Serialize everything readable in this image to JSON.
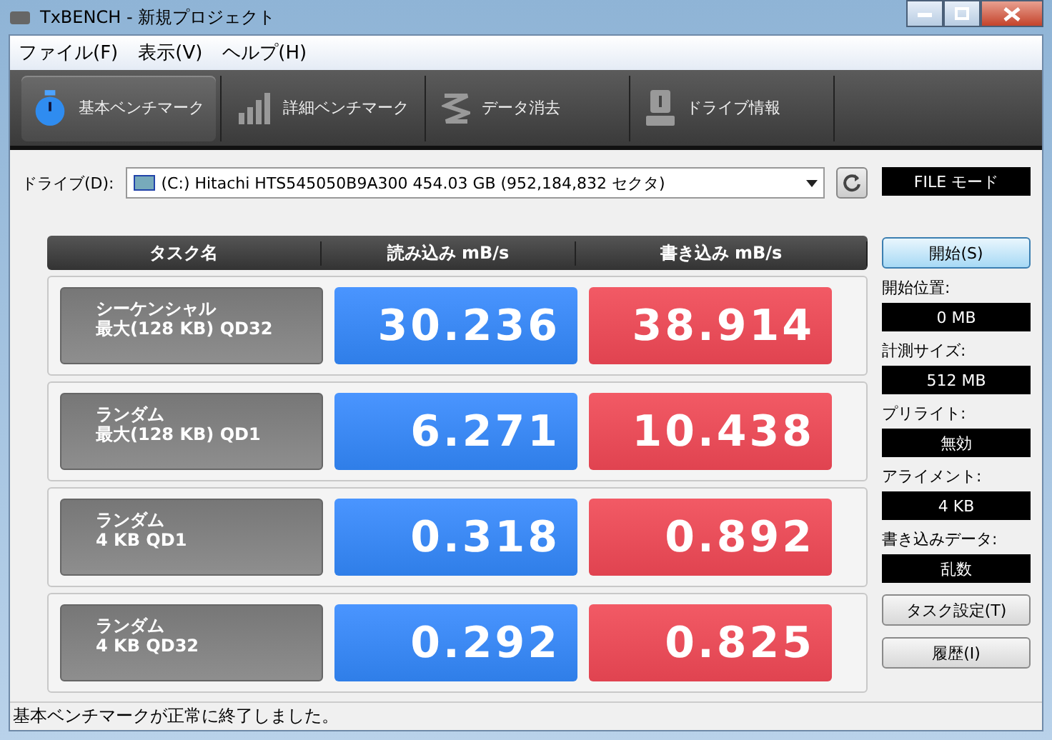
{
  "window": {
    "title": "TxBENCH - 新規プロジェクト"
  },
  "menu": [
    "ファイル(F)",
    "表示(V)",
    "ヘルプ(H)"
  ],
  "tabs": [
    {
      "label": "基本ベンチマーク",
      "selected": true
    },
    {
      "label": "詳細ベンチマーク",
      "selected": false
    },
    {
      "label": "データ消去",
      "selected": false
    },
    {
      "label": "ドライブ情報",
      "selected": false
    }
  ],
  "drive": {
    "label": "ドライブ(D):",
    "value": "(C:) Hitachi HTS545050B9A300  454.03 GB (952,184,832 セクタ)"
  },
  "mode": "FILE モード",
  "table": {
    "columns": [
      "タスク名",
      "読み込み mB/s",
      "書き込み mB/s"
    ],
    "rows": [
      {
        "name": [
          "シーケンシャル",
          "最大(128 KB) QD32"
        ],
        "read": "30.236",
        "write": "38.914"
      },
      {
        "name": [
          "ランダム",
          "最大(128 KB) QD1"
        ],
        "read": "6.271",
        "write": "10.438"
      },
      {
        "name": [
          "ランダム",
          "4 KB QD1"
        ],
        "read": "0.318",
        "write": "0.892"
      },
      {
        "name": [
          "ランダム",
          "4 KB QD32"
        ],
        "read": "0.292",
        "write": "0.825"
      }
    ]
  },
  "start_button": "開始(S)",
  "settings": [
    {
      "label": "開始位置:",
      "value": "0 MB"
    },
    {
      "label": "計測サイズ:",
      "value": "512 MB"
    },
    {
      "label": "プリライト:",
      "value": "無効"
    },
    {
      "label": "アライメント:",
      "value": "4 KB"
    },
    {
      "label": "書き込みデータ:",
      "value": "乱数"
    }
  ],
  "buttons": [
    "タスク設定(T)",
    "履歴(I)"
  ],
  "status_bar": "基本ベンチマークが正常に終了しました。"
}
